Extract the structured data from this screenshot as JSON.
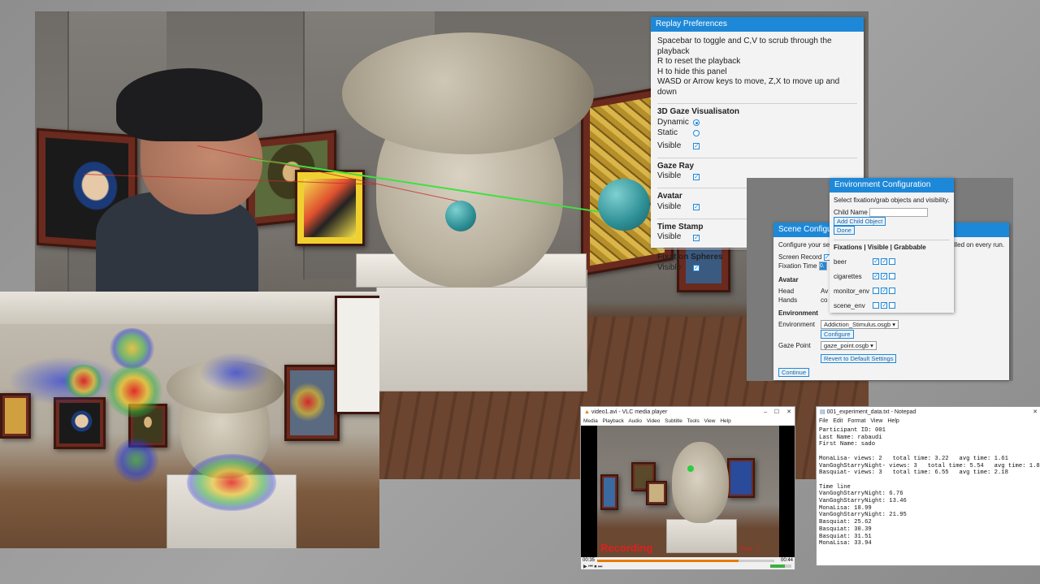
{
  "replay": {
    "title": "Replay Preferences",
    "help": [
      "Spacebar to toggle and C,V to scrub through the playback",
      "R to reset the playback",
      "H to hide this panel",
      "WASD or Arrow keys to move, Z,X to move up and down"
    ],
    "sections": {
      "gaze3d": "3D Gaze Visualisaton",
      "dynamic": "Dynamic",
      "static": "Static",
      "visible": "Visible",
      "gazeray": "Gaze Ray",
      "avatar": "Avatar",
      "timestamp": "Time Stamp",
      "fixation": "Fixation Spheres"
    }
  },
  "scene": {
    "title": "Scene Configura",
    "intro": "Configure your se",
    "intro_tail": "illed on every run.",
    "screen_record": "Screen Record",
    "fixation_time": "Fixation Time",
    "fixation_time_val": "0.",
    "avatar_header": "Avatar",
    "head_label": "Head",
    "head_val": "Av",
    "hands_label": "Hands",
    "hands_val": "co",
    "environment_header": "Environment",
    "environment_label": "Environment",
    "environment_value": "Addiction_Stimulus.osgb",
    "configure_btn": "Configure",
    "gaze_point_label": "Gaze Point",
    "gaze_point_value": "gaze_point.osgb",
    "revert_btn": "Revert to Default Settings",
    "continue_btn": "Continue"
  },
  "env": {
    "title": "Environment Configuration",
    "instructions": "Select fixation/grab objects and visibility.",
    "child_name_label": "Child Name",
    "add_child_btn": "Add Child Object",
    "done_btn": "Done",
    "table_header": "Fixations | Visible | Grabbable",
    "objects": [
      "beer",
      "cigarettes",
      "monitor_env",
      "scene_env"
    ]
  },
  "vlc": {
    "title": "video1.avi - VLC media player",
    "controls": [
      "–",
      "☐",
      "✕"
    ],
    "menu": [
      "Media",
      "Playback",
      "Audio",
      "Video",
      "Subtitle",
      "Tools",
      "View",
      "Help"
    ],
    "recording_label": "Recording",
    "time_label": "Time : 1",
    "elapsed": "00:35",
    "total": "00:44"
  },
  "notepad": {
    "title": "001_experiment_data.txt - Notepad",
    "menu": [
      "File",
      "Edit",
      "Format",
      "View",
      "Help"
    ],
    "lines": [
      "Participant ID: 001",
      "Last Name: rabaudi",
      "First Name: sado",
      "",
      "MonaLisa- views: 2   total time: 3.22   avg time: 1.61",
      "VanGoghStarryNight- views: 3   total time: 5.54   avg time: 1.85",
      "Basquiat- views: 3   total time: 6.55   avg time: 2.18",
      "",
      "Time line",
      "VanGoghStarryNight: 6.76",
      "VanGoghStarryNight: 13.46",
      "MonaLisa: 18.99",
      "VanGoghStarryNight: 21.95",
      "Basquiat: 25.62",
      "Basquiat: 30.39",
      "Basquiat: 31.51",
      "MonaLisa: 33.94"
    ]
  },
  "colors": {
    "panel_title": "#1e88d8",
    "gaze_ray": "#3fe03f",
    "sphere": "#2c8e94",
    "recording": "#e0201c"
  }
}
